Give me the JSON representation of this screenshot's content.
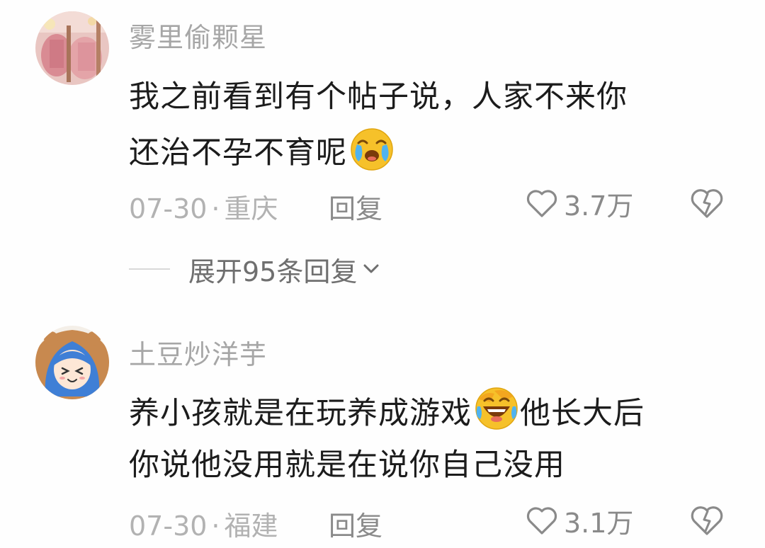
{
  "comments": [
    {
      "username": "雾里偷颗星",
      "lines": [
        "我之前看到有个帖子说，人家不来你",
        "还治不孕不育呢"
      ],
      "emoji_line2": "crying-emoji",
      "date": "07-30",
      "separator": "·",
      "location": "重庆",
      "reply_label": "回复",
      "likes": "3.7万",
      "avatar": "pink-items-avatar"
    },
    {
      "username": "土豆炒洋芋",
      "lines": [
        "养小孩就是在玩养成游戏",
        "他长大后",
        "你说他没用就是在说你自己没用"
      ],
      "emoji_line1": "laughing-crying-emoji",
      "date": "07-30",
      "separator": "·",
      "location": "福建",
      "reply_label": "回复",
      "likes": "3.1万",
      "avatar": "anime-girl-avatar"
    }
  ],
  "expand_replies": {
    "label": "展开95条回复"
  },
  "colors": {
    "username": "#a6a6a6",
    "body_text": "#1c1c1c",
    "meta": "#b2b2b2",
    "action": "#8a8a8a"
  }
}
